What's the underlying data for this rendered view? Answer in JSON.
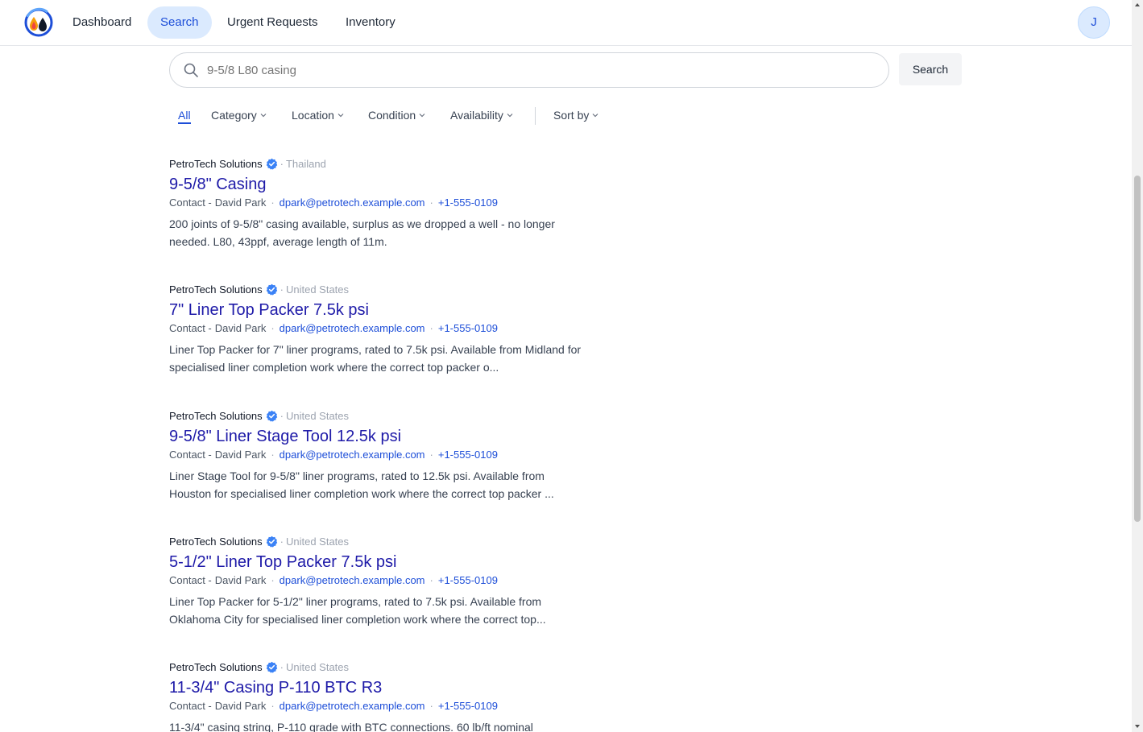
{
  "nav": {
    "items": [
      {
        "label": "Dashboard",
        "active": false
      },
      {
        "label": "Search",
        "active": true
      },
      {
        "label": "Urgent Requests",
        "active": false
      },
      {
        "label": "Inventory",
        "active": false
      }
    ],
    "avatar_initial": "J"
  },
  "search": {
    "value": "",
    "placeholder": "9-5/8 L80 casing",
    "button_label": "Search"
  },
  "filters": {
    "all_label": "All",
    "category_label": "Category",
    "location_label": "Location",
    "condition_label": "Condition",
    "availability_label": "Availability",
    "sort_label": "Sort by"
  },
  "results": [
    {
      "company": "PetroTech Solutions",
      "country": "Thailand",
      "title": "9-5/8\" Casing",
      "contact_label": "Contact -",
      "contact_name": "David Park",
      "email": "dpark@petrotech.example.com",
      "phone": "+1-555-0109",
      "description": "200 joints of 9-5/8\" casing available, surplus as we dropped a well - no longer needed. L80, 43ppf, average length of 11m."
    },
    {
      "company": "PetroTech Solutions",
      "country": "United States",
      "title": "7\" Liner Top Packer 7.5k psi",
      "contact_label": "Contact -",
      "contact_name": "David Park",
      "email": "dpark@petrotech.example.com",
      "phone": "+1-555-0109",
      "description": "Liner Top Packer for 7\" liner programs, rated to 7.5k psi. Available from Midland for specialised liner completion work where the correct top packer o..."
    },
    {
      "company": "PetroTech Solutions",
      "country": "United States",
      "title": "9-5/8\" Liner Stage Tool 12.5k psi",
      "contact_label": "Contact -",
      "contact_name": "David Park",
      "email": "dpark@petrotech.example.com",
      "phone": "+1-555-0109",
      "description": "Liner Stage Tool for 9-5/8\" liner programs, rated to 12.5k psi. Available from Houston for specialised liner completion work where the correct top packer ..."
    },
    {
      "company": "PetroTech Solutions",
      "country": "United States",
      "title": "5-1/2\" Liner Top Packer 7.5k psi",
      "contact_label": "Contact -",
      "contact_name": "David Park",
      "email": "dpark@petrotech.example.com",
      "phone": "+1-555-0109",
      "description": "Liner Top Packer for 5-1/2\" liner programs, rated to 7.5k psi. Available from Oklahoma City for specialised liner completion work where the correct top..."
    },
    {
      "company": "PetroTech Solutions",
      "country": "United States",
      "title": "11-3/4\" Casing P-110 BTC R3",
      "contact_label": "Contact -",
      "contact_name": "David Park",
      "email": "dpark@petrotech.example.com",
      "phone": "+1-555-0109",
      "description": "11-3/4\" casing string, P-110 grade with BTC connections. 60 lb/ft nominal"
    }
  ],
  "colors": {
    "accent": "#1d4ed8",
    "active_nav_bg": "#dbeafe",
    "title_link": "#1e1aa8",
    "verified_badge": "#3b82f6"
  }
}
